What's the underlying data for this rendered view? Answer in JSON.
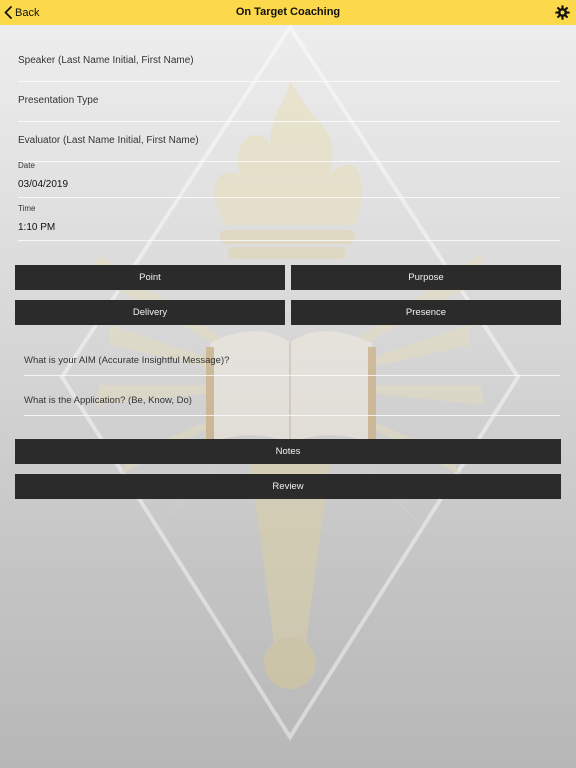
{
  "header": {
    "back_label": "Back",
    "title": "On Target Coaching",
    "settings_icon": "gear-icon",
    "back_icon": "chevron-left-icon",
    "background_color": "#fcd94a"
  },
  "form": {
    "speaker_placeholder": "Speaker (Last Name Initial, First Name)",
    "presentation_type_placeholder": "Presentation Type",
    "evaluator_placeholder": "Evaluator (Last Name Initial, First Name)",
    "date_label": "Date",
    "date_value": "03/04/2019",
    "time_label": "Time",
    "time_value": "1:10 PM"
  },
  "sections": {
    "point_label": "Point",
    "purpose_label": "Purpose",
    "delivery_label": "Delivery",
    "presence_label": "Presence"
  },
  "questions": {
    "aim_placeholder": "What is your AIM (Accurate Insightful Message)?",
    "application_placeholder": "What is the Application? (Be, Know, Do)"
  },
  "actions": {
    "notes_label": "Notes",
    "review_label": "Review"
  },
  "colors": {
    "button_background": "#2b2b2b",
    "button_text": "#f2f2f2"
  }
}
